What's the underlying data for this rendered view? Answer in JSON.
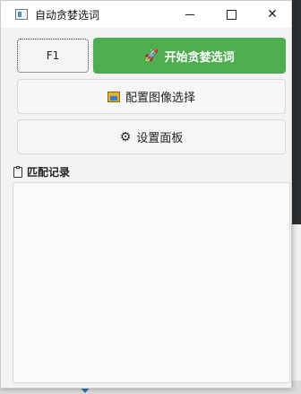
{
  "window": {
    "title": "自动贪婪选词"
  },
  "toolbar": {
    "hotkey_label": "F1",
    "start_label": "开始贪婪选词",
    "config_label": "配置图像选择",
    "settings_label": "设置面板"
  },
  "records": {
    "label": "匹配记录",
    "items": []
  },
  "colors": {
    "start_button": "#4cae4f",
    "window_bg": "#f3f3f3"
  },
  "icons": {
    "start": "rocket-icon",
    "config": "image-icon",
    "settings": "gear-icon",
    "records": "clipboard-icon"
  }
}
